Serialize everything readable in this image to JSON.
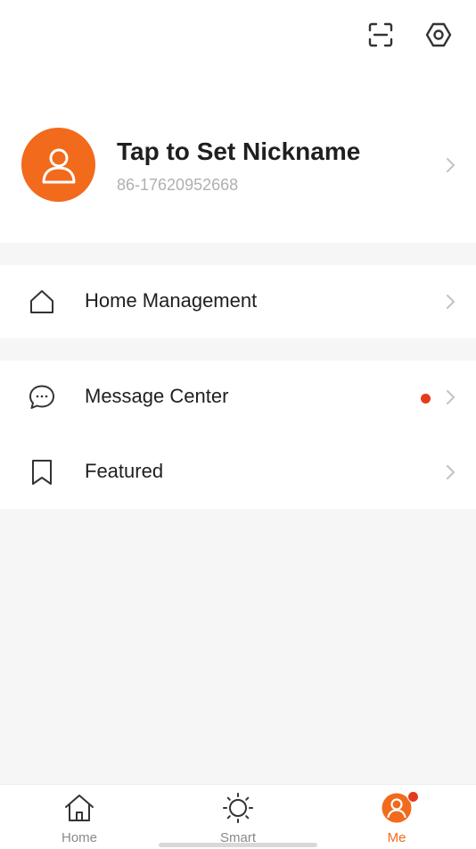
{
  "header": {
    "scan_icon": "scan-icon",
    "settings_icon": "settings-hexagon-icon"
  },
  "profile": {
    "nickname": "Tap to Set Nickname",
    "phone": "86-17620952668",
    "avatar_icon": "user-icon",
    "avatar_color": "#f26a1b"
  },
  "menu": {
    "home_management": {
      "label": "Home Management",
      "icon": "house-icon"
    },
    "message_center": {
      "label": "Message Center",
      "icon": "chat-bubble-icon",
      "has_unread": true
    },
    "featured": {
      "label": "Featured",
      "icon": "bookmark-icon"
    }
  },
  "tabbar": {
    "tabs": [
      {
        "label": "Home",
        "icon": "home-icon",
        "active": false
      },
      {
        "label": "Smart",
        "icon": "sun-icon",
        "active": false
      },
      {
        "label": "Me",
        "icon": "me-icon",
        "active": true,
        "badge": true
      }
    ]
  },
  "colors": {
    "accent": "#f26a1b",
    "badge": "#e53a1c",
    "background": "#f6f6f6",
    "secondary_text": "#b0b0b0"
  }
}
